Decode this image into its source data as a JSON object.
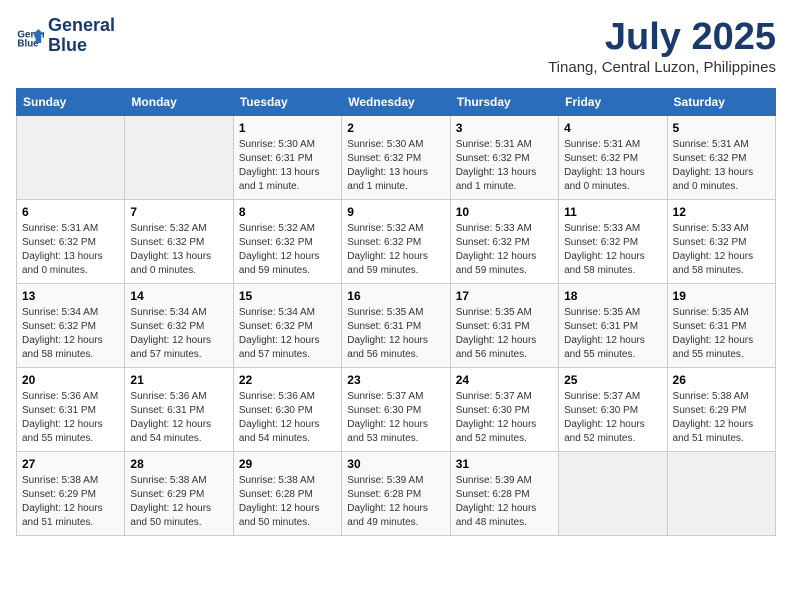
{
  "logo": {
    "line1": "General",
    "line2": "Blue"
  },
  "title": "July 2025",
  "subtitle": "Tinang, Central Luzon, Philippines",
  "weekdays": [
    "Sunday",
    "Monday",
    "Tuesday",
    "Wednesday",
    "Thursday",
    "Friday",
    "Saturday"
  ],
  "weeks": [
    [
      {
        "day": "",
        "info": ""
      },
      {
        "day": "",
        "info": ""
      },
      {
        "day": "1",
        "info": "Sunrise: 5:30 AM\nSunset: 6:31 PM\nDaylight: 13 hours and 1 minute."
      },
      {
        "day": "2",
        "info": "Sunrise: 5:30 AM\nSunset: 6:32 PM\nDaylight: 13 hours and 1 minute."
      },
      {
        "day": "3",
        "info": "Sunrise: 5:31 AM\nSunset: 6:32 PM\nDaylight: 13 hours and 1 minute."
      },
      {
        "day": "4",
        "info": "Sunrise: 5:31 AM\nSunset: 6:32 PM\nDaylight: 13 hours and 0 minutes."
      },
      {
        "day": "5",
        "info": "Sunrise: 5:31 AM\nSunset: 6:32 PM\nDaylight: 13 hours and 0 minutes."
      }
    ],
    [
      {
        "day": "6",
        "info": "Sunrise: 5:31 AM\nSunset: 6:32 PM\nDaylight: 13 hours and 0 minutes."
      },
      {
        "day": "7",
        "info": "Sunrise: 5:32 AM\nSunset: 6:32 PM\nDaylight: 13 hours and 0 minutes."
      },
      {
        "day": "8",
        "info": "Sunrise: 5:32 AM\nSunset: 6:32 PM\nDaylight: 12 hours and 59 minutes."
      },
      {
        "day": "9",
        "info": "Sunrise: 5:32 AM\nSunset: 6:32 PM\nDaylight: 12 hours and 59 minutes."
      },
      {
        "day": "10",
        "info": "Sunrise: 5:33 AM\nSunset: 6:32 PM\nDaylight: 12 hours and 59 minutes."
      },
      {
        "day": "11",
        "info": "Sunrise: 5:33 AM\nSunset: 6:32 PM\nDaylight: 12 hours and 58 minutes."
      },
      {
        "day": "12",
        "info": "Sunrise: 5:33 AM\nSunset: 6:32 PM\nDaylight: 12 hours and 58 minutes."
      }
    ],
    [
      {
        "day": "13",
        "info": "Sunrise: 5:34 AM\nSunset: 6:32 PM\nDaylight: 12 hours and 58 minutes."
      },
      {
        "day": "14",
        "info": "Sunrise: 5:34 AM\nSunset: 6:32 PM\nDaylight: 12 hours and 57 minutes."
      },
      {
        "day": "15",
        "info": "Sunrise: 5:34 AM\nSunset: 6:32 PM\nDaylight: 12 hours and 57 minutes."
      },
      {
        "day": "16",
        "info": "Sunrise: 5:35 AM\nSunset: 6:31 PM\nDaylight: 12 hours and 56 minutes."
      },
      {
        "day": "17",
        "info": "Sunrise: 5:35 AM\nSunset: 6:31 PM\nDaylight: 12 hours and 56 minutes."
      },
      {
        "day": "18",
        "info": "Sunrise: 5:35 AM\nSunset: 6:31 PM\nDaylight: 12 hours and 55 minutes."
      },
      {
        "day": "19",
        "info": "Sunrise: 5:35 AM\nSunset: 6:31 PM\nDaylight: 12 hours and 55 minutes."
      }
    ],
    [
      {
        "day": "20",
        "info": "Sunrise: 5:36 AM\nSunset: 6:31 PM\nDaylight: 12 hours and 55 minutes."
      },
      {
        "day": "21",
        "info": "Sunrise: 5:36 AM\nSunset: 6:31 PM\nDaylight: 12 hours and 54 minutes."
      },
      {
        "day": "22",
        "info": "Sunrise: 5:36 AM\nSunset: 6:30 PM\nDaylight: 12 hours and 54 minutes."
      },
      {
        "day": "23",
        "info": "Sunrise: 5:37 AM\nSunset: 6:30 PM\nDaylight: 12 hours and 53 minutes."
      },
      {
        "day": "24",
        "info": "Sunrise: 5:37 AM\nSunset: 6:30 PM\nDaylight: 12 hours and 52 minutes."
      },
      {
        "day": "25",
        "info": "Sunrise: 5:37 AM\nSunset: 6:30 PM\nDaylight: 12 hours and 52 minutes."
      },
      {
        "day": "26",
        "info": "Sunrise: 5:38 AM\nSunset: 6:29 PM\nDaylight: 12 hours and 51 minutes."
      }
    ],
    [
      {
        "day": "27",
        "info": "Sunrise: 5:38 AM\nSunset: 6:29 PM\nDaylight: 12 hours and 51 minutes."
      },
      {
        "day": "28",
        "info": "Sunrise: 5:38 AM\nSunset: 6:29 PM\nDaylight: 12 hours and 50 minutes."
      },
      {
        "day": "29",
        "info": "Sunrise: 5:38 AM\nSunset: 6:28 PM\nDaylight: 12 hours and 50 minutes."
      },
      {
        "day": "30",
        "info": "Sunrise: 5:39 AM\nSunset: 6:28 PM\nDaylight: 12 hours and 49 minutes."
      },
      {
        "day": "31",
        "info": "Sunrise: 5:39 AM\nSunset: 6:28 PM\nDaylight: 12 hours and 48 minutes."
      },
      {
        "day": "",
        "info": ""
      },
      {
        "day": "",
        "info": ""
      }
    ]
  ]
}
